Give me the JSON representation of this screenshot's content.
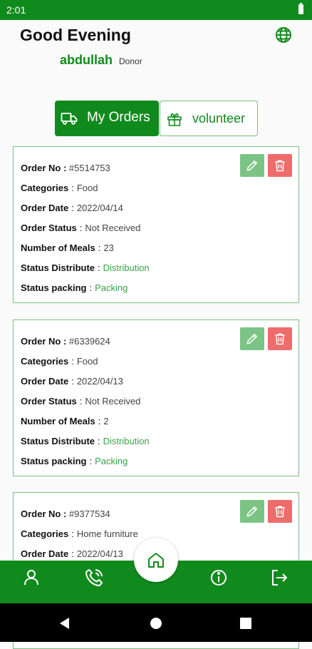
{
  "status_bar": {
    "time": "2:01"
  },
  "header": {
    "greeting": "Good Evening",
    "username": "abdullah",
    "role": "Donor"
  },
  "tabs": [
    {
      "label": "My Orders",
      "icon": "truck-icon",
      "active": true
    },
    {
      "label": "volunteer",
      "icon": "gift-icon",
      "active": false
    }
  ],
  "orders": [
    {
      "order_no_label": "Order No :",
      "order_no": "#5514753",
      "categories_label": "Categories",
      "categories": "Food",
      "order_date_label": "Order Date",
      "order_date": "2022/04/14",
      "order_status_label": "Order Status",
      "order_status": "Not Received",
      "meals_label": "Number of Meals",
      "meals": "23",
      "distribute_label": "Status Distribute",
      "distribute": "Distribution",
      "packing_label": "Status packing",
      "packing": "Packing"
    },
    {
      "order_no_label": "Order No :",
      "order_no": "#6339624",
      "categories_label": "Categories",
      "categories": "Food",
      "order_date_label": "Order Date",
      "order_date": "2022/04/13",
      "order_status_label": "Order Status",
      "order_status": "Not Received",
      "meals_label": "Number of Meals",
      "meals": "2",
      "distribute_label": "Status Distribute",
      "distribute": "Distribution",
      "packing_label": "Status packing",
      "packing": "Packing"
    },
    {
      "order_no_label": "Order No :",
      "order_no": "#9377534",
      "categories_label": "Categories",
      "categories": "Home furniture",
      "order_date_label": "Order Date",
      "order_date": "2022/04/13"
    }
  ],
  "separator": ":",
  "bottom_nav": [
    "person-icon",
    "phone-icon",
    "home-icon",
    "info-icon",
    "logout-icon"
  ],
  "colors": {
    "primary": "#118a1d",
    "accent_light": "#7cc486",
    "delete": "#ef6c6c",
    "status_green": "#3aa34a"
  }
}
